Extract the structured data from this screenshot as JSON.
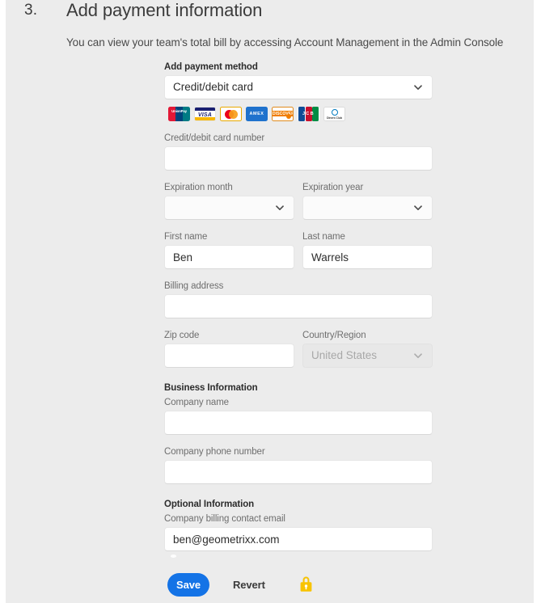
{
  "step": {
    "number": "3.",
    "title": "Add payment information",
    "subtitle": "You can view your team's total bill by accessing Account Management in the Admin Console"
  },
  "form": {
    "payment_method": {
      "label": "Add payment method",
      "value": "Credit/debit card",
      "chevron_icon": "chevron-down-icon"
    },
    "accepted_cards": [
      {
        "name": "unionpay",
        "label": "UnionPay"
      },
      {
        "name": "visa",
        "label": "VISA"
      },
      {
        "name": "mastercard",
        "label": "Mastercard"
      },
      {
        "name": "amex",
        "label": "AMEX"
      },
      {
        "name": "discover",
        "label": "DISCOVER"
      },
      {
        "name": "jcb",
        "label": "JCB"
      },
      {
        "name": "diners",
        "label": "Diners Club"
      }
    ],
    "card_number": {
      "label": "Credit/debit card number",
      "value": "",
      "placeholder": ""
    },
    "expiration_month": {
      "label": "Expiration month",
      "value": ""
    },
    "expiration_year": {
      "label": "Expiration year",
      "value": ""
    },
    "first_name": {
      "label": "First name",
      "value": "Ben"
    },
    "last_name": {
      "label": "Last name",
      "value": "Warrels"
    },
    "billing_address": {
      "label": "Billing address",
      "value": ""
    },
    "zip_code": {
      "label": "Zip code",
      "value": ""
    },
    "country_region": {
      "label": "Country/Region",
      "value": "United States",
      "disabled": true
    },
    "business_information_heading": "Business Information",
    "company_name": {
      "label": "Company name",
      "value": ""
    },
    "company_phone": {
      "label": "Company phone number",
      "value": ""
    },
    "optional_information_heading": "Optional Information",
    "billing_contact_email": {
      "label": "Company billing contact email",
      "value": "ben@geometrixx.com"
    }
  },
  "footer": {
    "save_label": "Save",
    "revert_label": "Revert",
    "lock_icon": "lock-icon"
  },
  "colors": {
    "page_background": "#ececec",
    "field_background": "#ffffff",
    "primary_button": "#1473e6",
    "text_primary": "#2c2c2c",
    "text_label": "#6e6e6e",
    "lock_icon": "#f8c300"
  }
}
